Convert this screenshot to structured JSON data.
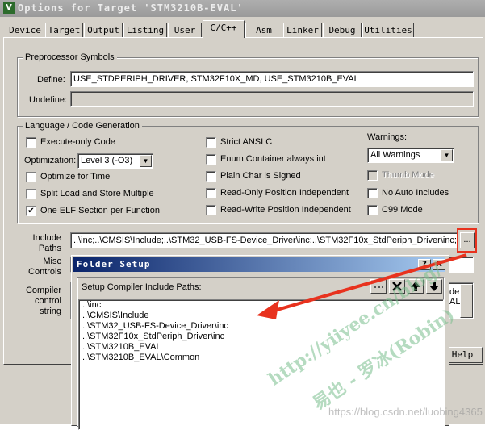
{
  "window": {
    "title": "Options for Target 'STM3210B-EVAL'"
  },
  "tabs": [
    "Device",
    "Target",
    "Output",
    "Listing",
    "User",
    "C/C++",
    "Asm",
    "Linker",
    "Debug",
    "Utilities"
  ],
  "active_tab": "C/C++",
  "preprocessor": {
    "group_label": "Preprocessor Symbols",
    "define_label": "Define:",
    "define_value": "USE_STDPERIPH_DRIVER, STM32F10X_MD, USE_STM3210B_EVAL",
    "undefine_label": "Undefine:",
    "undefine_value": ""
  },
  "language": {
    "group_label": "Language / Code Generation",
    "execute_only": {
      "label": "Execute-only Code",
      "checked": false
    },
    "optimization_label": "Optimization:",
    "optimization_value": "Level 3 (-O3)",
    "optimize_time": {
      "label": "Optimize for Time",
      "checked": false
    },
    "split_load": {
      "label": "Split Load and Store Multiple",
      "checked": false
    },
    "one_elf": {
      "label": "One ELF Section per Function",
      "checked": true
    },
    "strict_ansi": {
      "label": "Strict ANSI C",
      "checked": false
    },
    "enum_int": {
      "label": "Enum Container always int",
      "checked": false
    },
    "plain_char": {
      "label": "Plain Char is Signed",
      "checked": false
    },
    "ro_pi": {
      "label": "Read-Only Position Independent",
      "checked": false
    },
    "rw_pi": {
      "label": "Read-Write Position Independent",
      "checked": false
    },
    "warnings_label": "Warnings:",
    "warnings_value": "All Warnings",
    "thumb_mode": {
      "label": "Thumb Mode",
      "checked": false
    },
    "no_auto_includes": {
      "label": "No Auto Includes",
      "checked": false
    },
    "c99_mode": {
      "label": "C99 Mode",
      "checked": false
    }
  },
  "include": {
    "label_line1": "Include",
    "label_line2": "Paths",
    "value": "..\\inc;..\\CMSIS\\Include;..\\STM32_USB-FS-Device_Driver\\inc;..\\STM32F10x_StdPeriph_Driver\\inc;",
    "browse_label": "..."
  },
  "misc": {
    "label_line1": "Misc",
    "label_line2": "Controls"
  },
  "compiler": {
    "label_line1": "Compiler",
    "label_line2": "control",
    "label_line3": "string",
    "partial_right1": "de",
    "partial_right2": "AL"
  },
  "help_button": "Help",
  "folder_setup": {
    "title": "Folder Setup",
    "help_btn": "?",
    "close_btn": "X",
    "list_label": "Setup Compiler Include Paths:",
    "paths": [
      "..\\inc",
      "..\\CMSIS\\Include",
      "..\\STM32_USB-FS-Device_Driver\\inc",
      "..\\STM32F10x_StdPeriph_Driver\\inc",
      "..\\STM3210B_EVAL",
      "..\\STM3210B_EVAL\\Common"
    ]
  },
  "watermark": {
    "line1": "http://yiiyee.cn/blog/",
    "line2": "易也 - 罗冰(Robin)",
    "url": "https://blog.csdn.net/luobing4365"
  },
  "colors": {
    "arrow": "#e8321e",
    "title_active": "#0a246a",
    "dialog_bg": "#d4d0c8"
  }
}
